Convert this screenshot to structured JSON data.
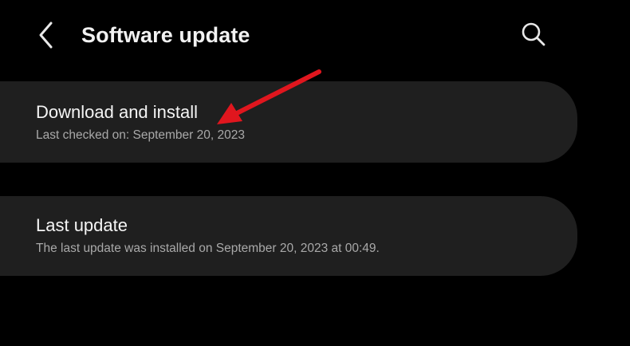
{
  "header": {
    "title": "Software update",
    "back_icon": "chevron-left-icon",
    "search_icon": "search-icon"
  },
  "items": [
    {
      "title": "Download and install",
      "subtitle": "Last checked on: September 20, 2023"
    },
    {
      "title": "Last update",
      "subtitle": "The last update was installed on September 20, 2023 at 00:49."
    }
  ],
  "annotation": {
    "type": "arrow",
    "color": "#e0161e",
    "points_to": "Download and install"
  },
  "colors": {
    "background": "#000000",
    "card": "#1f1f1f",
    "title_text": "#f5f5f5",
    "subtitle_text": "#a9a9a9"
  }
}
